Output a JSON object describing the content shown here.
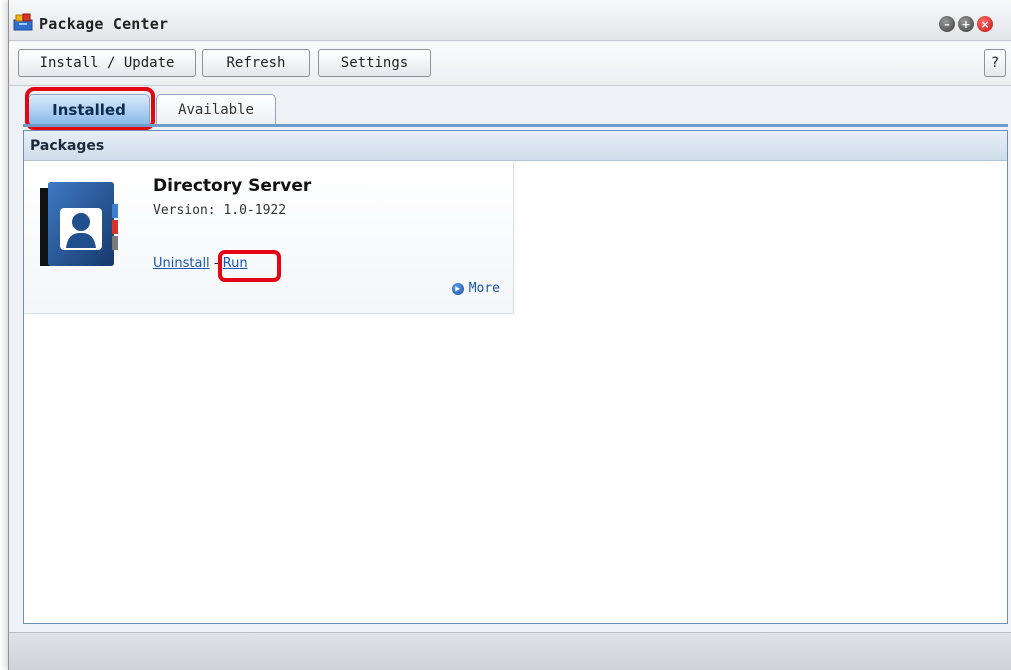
{
  "window": {
    "title": "Package Center",
    "icon": "package-center-icon",
    "controls": [
      "minimize-icon",
      "maximize-icon",
      "close-icon"
    ]
  },
  "toolbar": {
    "install_update_label": "Install / Update",
    "refresh_label": "Refresh",
    "settings_label": "Settings",
    "help_label": "?"
  },
  "tabs": [
    {
      "label": "Installed",
      "selected": true
    },
    {
      "label": "Available",
      "selected": false
    }
  ],
  "panel": {
    "header": "Packages"
  },
  "package": {
    "name": "Directory Server",
    "version": "Version: 1.0-1922",
    "uninstall_label": "Uninstall",
    "separator": "-",
    "run_label": "Run",
    "more_label": "More",
    "icon": "directory-server-icon"
  },
  "colors": {
    "highlight": "#e30613",
    "accent": "#89b9e8",
    "link": "#1a56b8"
  }
}
